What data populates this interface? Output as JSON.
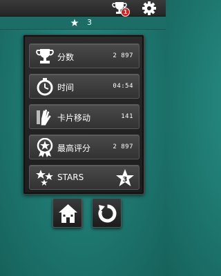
{
  "header": {
    "trophy_badge": "1",
    "star_count": "3"
  },
  "stats": [
    {
      "icon": "trophy-icon",
      "label": "分数",
      "value": "2 897"
    },
    {
      "icon": "stopwatch-icon",
      "label": "时间",
      "value": "04:54"
    },
    {
      "icon": "hand-card-icon",
      "label": "卡片移动",
      "value": "141"
    },
    {
      "icon": "medal-star-icon",
      "label": "最高评分",
      "value": "2 897"
    },
    {
      "icon": "stars-icon",
      "label": "STARS",
      "value": "3"
    }
  ],
  "colors": {
    "background": "#1f7b73",
    "badge": "#d62020",
    "panel": "#262626"
  }
}
